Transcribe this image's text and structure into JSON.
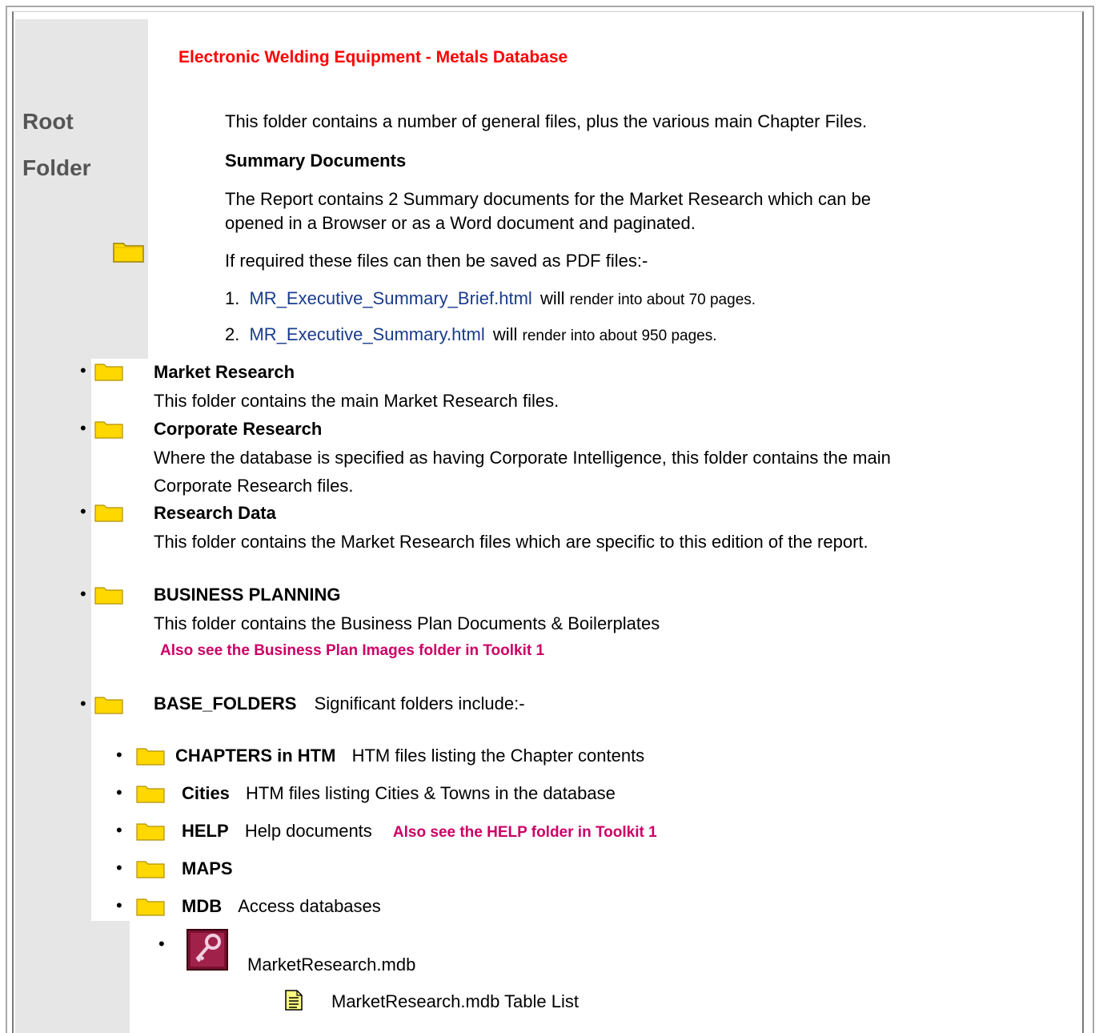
{
  "header": {
    "title": "Electronic Welding Equipment - Metals Database",
    "root_label_1": "Root",
    "root_label_2": "Folder"
  },
  "intro": {
    "line1": "This folder contains a number of general files, plus the various main Chapter Files.",
    "summary_heading": "Summary Documents",
    "summary_p1": "The Report contains 2 Summary documents for the Market Research which can be",
    "summary_p2": "opened in a Browser or as a Word document and paginated.",
    "pdf_line": "If required these files can then be saved as PDF files:-",
    "items": [
      {
        "num": "1.",
        "link": "MR_Executive_Summary_Brief.html",
        "will": "will",
        "rest": "render into about 70 pages."
      },
      {
        "num": "2.",
        "link": "MR_Executive_Summary.html",
        "will": "will",
        "rest": "render into about 950 pages."
      }
    ]
  },
  "folders": [
    {
      "name": "Market Research",
      "desc": "This folder contains the main Market Research files."
    },
    {
      "name": "Corporate Research",
      "desc1": "Where the database is specified as having Corporate Intelligence, this folder contains the main",
      "desc2": "Corporate Research files."
    },
    {
      "name": "Research Data",
      "desc": "This folder contains the Market Research files which are specific to this edition of the report."
    },
    {
      "name": "BUSINESS PLANNING",
      "desc": "This folder contains the Business Plan Documents & Boilerplates",
      "note": "Also see the Business Plan Images folder in Toolkit 1"
    },
    {
      "name": "BASE_FOLDERS",
      "desc": "Significant folders include:-"
    }
  ],
  "subfolders": [
    {
      "name": "CHAPTERS in HTM",
      "desc": "HTM files listing the Chapter contents"
    },
    {
      "name": "Cities",
      "desc": "HTM files listing Cities & Towns in the database"
    },
    {
      "name": "HELP",
      "desc": "Help documents",
      "note": "Also see the HELP folder in Toolkit 1"
    },
    {
      "name": "MAPS",
      "desc": ""
    },
    {
      "name": "MDB",
      "desc": "Access databases"
    }
  ],
  "mdb": {
    "file": "MarketResearch.mdb",
    "table_list": "MarketResearch.mdb Table List"
  },
  "icons": {
    "folder": "folder-icon",
    "access": "access-database-icon",
    "document": "document-icon"
  },
  "colors": {
    "title": "#ff0000",
    "link": "#1a3c8c",
    "note": "#cc0066",
    "folder": "#ffd700",
    "shade": "#e6e6e6"
  }
}
